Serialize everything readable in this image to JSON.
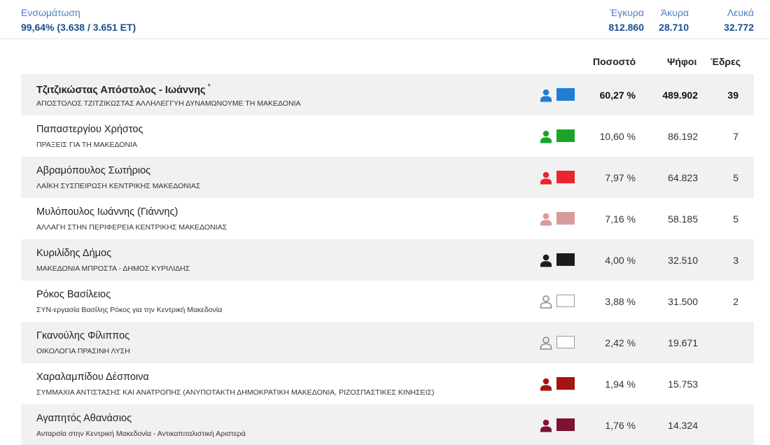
{
  "header": {
    "integration_label": "Ενσωμάτωση",
    "integration_value": "99,64% (3.638 / 3.651 ΕΤ)",
    "valid_label": "Έγκυρα",
    "valid_value": "812.860",
    "invalid_label": "Άκυρα",
    "invalid_value": "28.710",
    "blank_label": "Λευκά",
    "blank_value": "32.772"
  },
  "columns": {
    "percent": "Ποσοστό",
    "votes": "Ψήφοι",
    "seats": "Έδρες"
  },
  "candidates": [
    {
      "name": "Τζιτζικώστας Απόστολος - Ιωάννης",
      "marker": "*",
      "party": "ΑΠΟΣΤΟΛΟΣ ΤΖΙΤΖΙΚΩΣΤΑΣ ΑΛΛΗΛΕΓΓΥΗ ΔΥΝΑΜΩΝΟΥΜΕ ΤΗ ΜΑΚΕΔΟΝΙΑ",
      "percent": "60,27 %",
      "votes": "489.902",
      "seats": "39",
      "color": "#1f7dd6",
      "icon": "person-icon"
    },
    {
      "name": "Παπαστεργίου Χρήστος",
      "marker": "",
      "party": "ΠΡΑΞΕΙΣ ΓΙΑ ΤΗ ΜΑΚΕΔΟΝΙΑ",
      "percent": "10,60 %",
      "votes": "86.192",
      "seats": "7",
      "color": "#1aa52a",
      "icon": "person-icon"
    },
    {
      "name": "Αβραμόπουλος Σωτήριος",
      "marker": "",
      "party": "ΛΑΪΚΗ ΣΥΣΠΕΙΡΩΣΗ ΚΕΝΤΡΙΚΗΣ ΜΑΚΕΔΟΝΙΑΣ",
      "percent": "7,97 %",
      "votes": "64.823",
      "seats": "5",
      "color": "#e8262d",
      "icon": "person-icon"
    },
    {
      "name": "Μυλόπουλος Ιωάννης (Γιάννης)",
      "marker": "",
      "party": "ΑΛΛΑΓΗ ΣΤΗΝ ΠΕΡΙΦΕΡΕΙΑ ΚΕΝΤΡΙΚΗΣ ΜΑΚΕΔΟΝΙΑΣ",
      "percent": "7,16 %",
      "votes": "58.185",
      "seats": "5",
      "color": "#d99a9a",
      "icon": "person-icon"
    },
    {
      "name": "Κυριλίδης Δήμος",
      "marker": "",
      "party": "ΜΑΚΕΔΟΝΙΑ ΜΠΡΟΣΤΑ - ΔΗΜΟΣ ΚΥΡΙΛΙΔΗΣ",
      "percent": "4,00 %",
      "votes": "32.510",
      "seats": "3",
      "color": "#1c1c1c",
      "icon": "person-icon"
    },
    {
      "name": "Ρόκος Βασίλειος",
      "marker": "",
      "party": "ΣΥΝ-εργασία Βασίλης Ρόκος για την Κεντρική Μακεδονία",
      "percent": "3,88 %",
      "votes": "31.500",
      "seats": "2",
      "color": "#ffffff",
      "icon": "person-outline-icon"
    },
    {
      "name": "Γκανούλης Φίλιππος",
      "marker": "",
      "party": "ΟΙΚΟΛΟΓΙΑ ΠΡΑΣΙΝΗ ΛΥΣΗ",
      "percent": "2,42 %",
      "votes": "19.671",
      "seats": "",
      "color": "#ffffff",
      "icon": "person-outline-icon"
    },
    {
      "name": "Χαραλαμπίδου Δέσποινα",
      "marker": "",
      "party": "ΣΥΜΜΑΧΙΑ ΑΝΤΙΣΤΑΣΗΣ ΚΑΙ ΑΝΑΤΡΟΠΗΣ (ΑΝΥΠΟΤΑΚΤΗ ΔΗΜΟΚΡΑΤΙΚΗ ΜΑΚΕΔΟΝΙΑ, ΡΙΖΟΣΠΑΣΤΙΚΕΣ ΚΙΝΗΣΕΙΣ)",
      "percent": "1,94 %",
      "votes": "15.753",
      "seats": "",
      "color": "#a5150f",
      "icon": "person-icon"
    },
    {
      "name": "Αγαπητός Αθανάσιος",
      "marker": "",
      "party": "Ανταρσία στην Κεντρική Μακεδονία - Αντικαπιταλιστική Αριστερά",
      "percent": "1,76 %",
      "votes": "14.324",
      "seats": "",
      "color": "#7d1232",
      "icon": "person-icon"
    }
  ]
}
